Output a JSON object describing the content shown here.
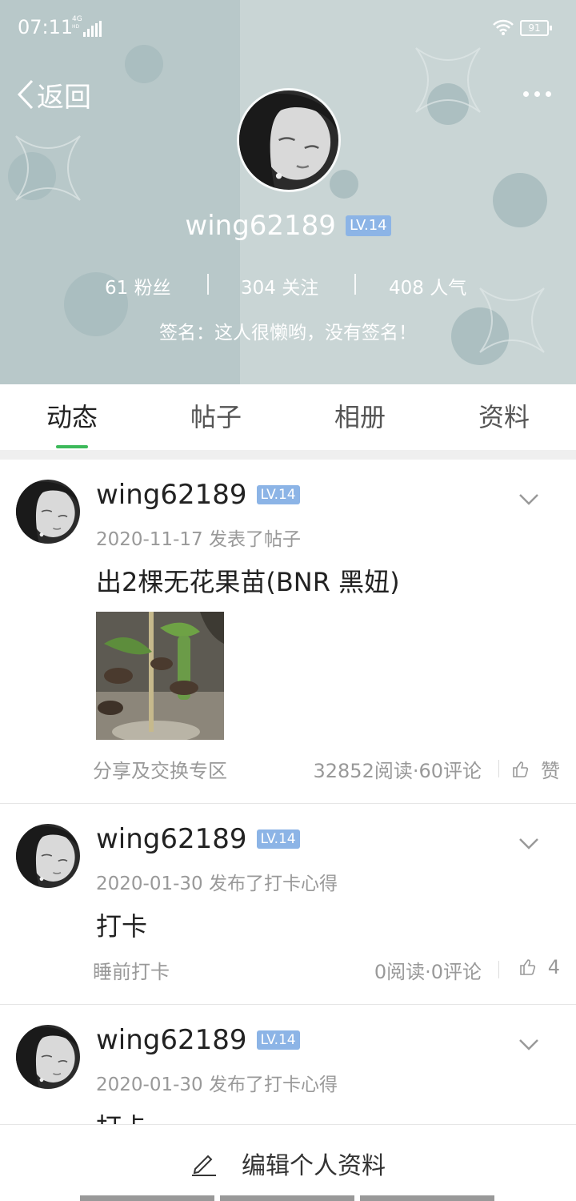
{
  "status_bar": {
    "time": "07:11",
    "network": "4G",
    "network_sub": "HD",
    "battery": "91"
  },
  "header": {
    "back_label": "返回",
    "username": "wing62189",
    "level": "LV.14",
    "stats": [
      {
        "label": "61 粉丝"
      },
      {
        "label": "304 关注"
      },
      {
        "label": "408 人气"
      }
    ],
    "signature": "签名：这人很懒哟，没有签名！"
  },
  "tabs": [
    {
      "label": "动态",
      "active": true
    },
    {
      "label": "帖子",
      "active": false
    },
    {
      "label": "相册",
      "active": false
    },
    {
      "label": "资料",
      "active": false
    }
  ],
  "posts": [
    {
      "name": "wing62189",
      "level": "LV.14",
      "meta": "2020-11-17  发表了帖子",
      "title": "出2棵无花果苗(BNR 黑妞)",
      "forum": "分享及交换专区",
      "counts": "32852阅读·60评论",
      "like": "赞"
    },
    {
      "name": "wing62189",
      "level": "LV.14",
      "meta": "2020-01-30  发布了打卡心得",
      "title": "打卡",
      "forum": "睡前打卡",
      "counts": "0阅读·0评论",
      "like": "4"
    },
    {
      "name": "wing62189",
      "level": "LV.14",
      "meta": "2020-01-30  发布了打卡心得",
      "title": "打卡"
    }
  ],
  "bottom": {
    "edit_label": "编辑个人资料"
  }
}
